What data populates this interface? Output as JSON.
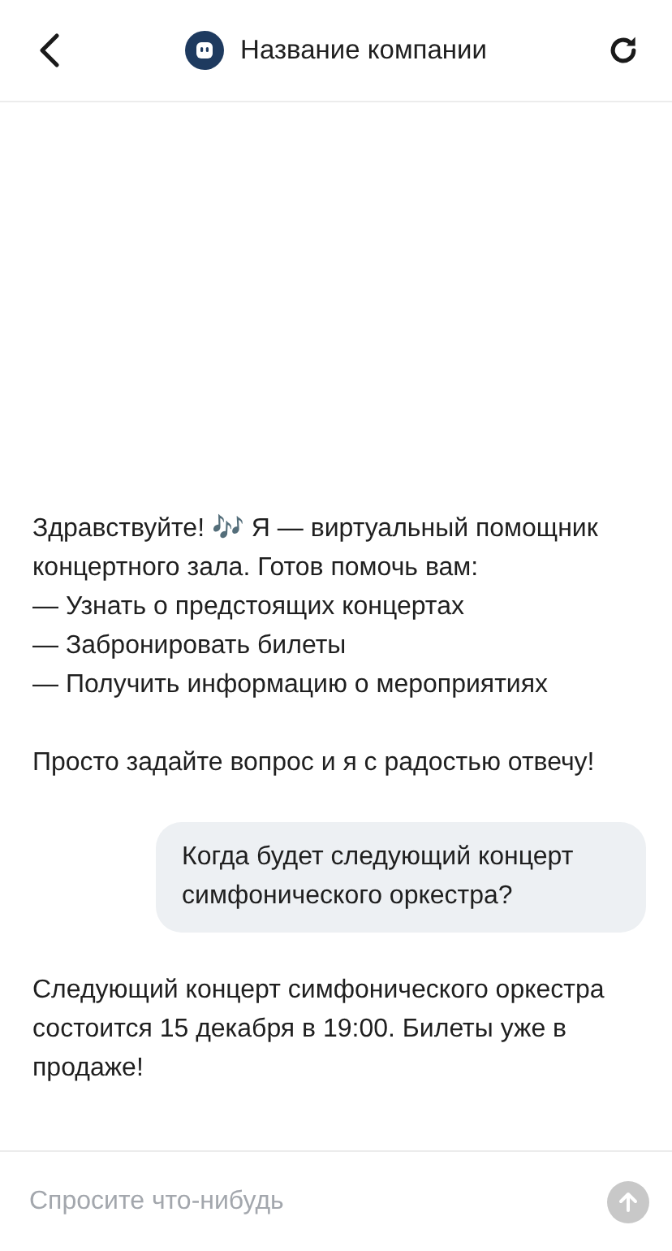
{
  "header": {
    "title": "Название компании"
  },
  "messages": [
    {
      "kind": "bot",
      "paragraphs": [
        "Здравствуйте! 🎶 Я — виртуальный помощник концертного зала. Готов помочь вам:",
        "— Узнать о предстоящих концертах",
        "— Забронировать билеты",
        "— Получить информацию о мероприятиях"
      ]
    },
    {
      "kind": "bot",
      "paragraphs": [
        "Просто задайте вопрос и я с радостью отвечу!"
      ]
    },
    {
      "kind": "user",
      "paragraphs": [
        "Когда будет следующий концерт симфонического оркестра?"
      ]
    },
    {
      "kind": "bot",
      "paragraphs": [
        "Следующий концерт симфонического оркестра состоится 15 декабря в 19:00. Билеты уже в продаже!"
      ]
    }
  ],
  "composer": {
    "placeholder": "Спросите что-нибудь",
    "send_disabled": true
  }
}
